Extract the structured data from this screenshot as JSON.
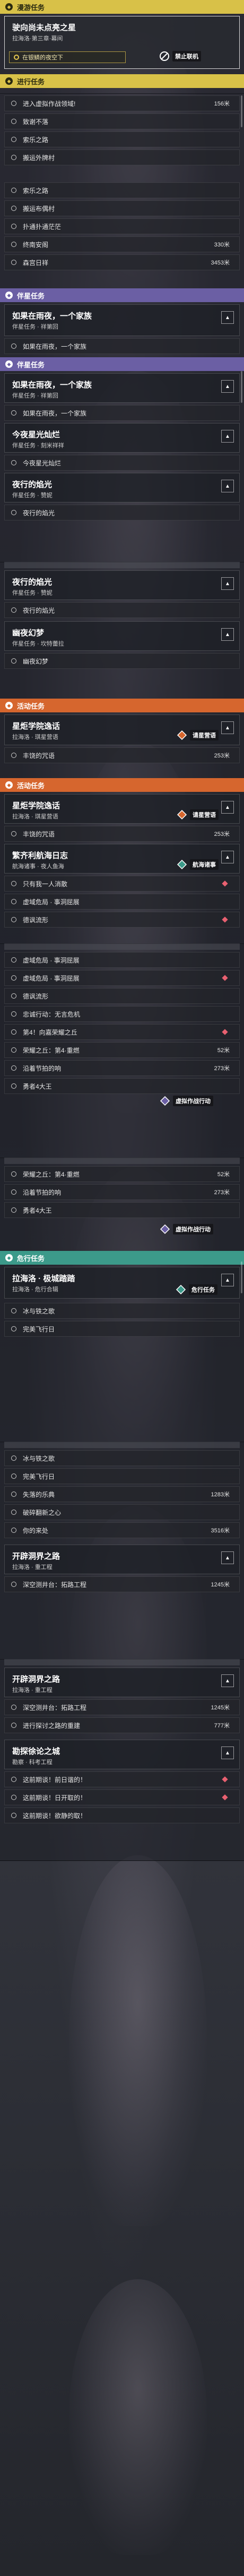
{
  "strings": {
    "header_travel": "漫游任务",
    "header_progress": "进行任务",
    "header_companion": "伴星任务",
    "header_activity": "活动任务",
    "header_danger": "危行任务",
    "travel_title": "驶向尚未点亮之星",
    "travel_sub": "拉海洛·第三章·幕间",
    "travel_obj": "在银鳞的夜空下",
    "travel_badge": "禁止联机",
    "pr1": "进入虚拟作战领域!",
    "pr1_dist": "156米",
    "pr2": "致谢不落",
    "pr3": "索乐之路",
    "pr4": "搬运外牌村",
    "pr5": "索乐之路",
    "pr6": "搬运布偶村",
    "pr7": "扑通扑通茫茫",
    "pr8": "终南安阁",
    "pr8_dist": "330米",
    "pr9": "森宫日祥",
    "pr9_dist": "3453米",
    "c1_title": "如果在雨夜，一个家族",
    "c1_sub": "伴星任务 · 祥第回",
    "c1_row": "如果在雨夜，一个家族",
    "c2_title": "如果在雨夜，一个家族",
    "c2_sub": "伴星任务 · 祥第回",
    "c2_row": "如果在雨夜，一个家族",
    "c3_title": "今夜星光灿烂",
    "c3_sub": "伴星任务 · 刻米祥祥",
    "c3_row": "今夜星光灿烂",
    "c4_title": "夜行的焰光",
    "c4_sub": "伴星任务 · 赞妮",
    "c4_row": "夜行的焰光",
    "c5_title": "夜行的焰光",
    "c5_sub": "伴星任务 · 赞妮",
    "c5_row": "夜行的焰光",
    "c6_title": "幽夜幻梦",
    "c6_sub": "伴星任务 · 坎特蕾拉",
    "c6_row": "幽夜幻梦",
    "a1_title": "星炬学院逸话",
    "a1_sub": "拉海洛 · 琪星营语",
    "a1_row": "丰饶的咒语",
    "a1_dist": "253米",
    "a1_badge": "请星营语",
    "a2_title": "星炬学院逸话",
    "a2_sub": "拉海洛 · 琪星营语",
    "a2_row": "丰饶的咒语",
    "a2_dist": "253米",
    "a2_badge": "请星营语",
    "a3_title": "繁齐利航海日志",
    "a3_sub": "航海诸事 · 夜人鱼海",
    "a3_badge": "航海诸事",
    "a3_r1": "只有我一人消散",
    "a3_r2": "虚域危局 · 事洞屈展",
    "a3_r3": "德讽流形",
    "frag1": "虚域危局 · 事洞屈展",
    "frag2": "虚域危局 · 事洞屈展",
    "frag3": "德讽流形",
    "frag4": "忠诚行动：无言危机",
    "frag5": "第4！向嘉荣耀之丘",
    "frag6": "荣耀之丘：第4·重燃",
    "frag6_dist": "52米",
    "frag7": "沿着节拍的响",
    "frag7_dist": "273米",
    "frag8": "勇者4大王",
    "frag_badge": "虚拟作战行动",
    "f2_1": "荣耀之丘：第4·重燃",
    "f2_1_dist": "52米",
    "f2_2": "沿着节拍的响",
    "f2_2_dist": "273米",
    "f2_3": "勇者4大王",
    "f2_badge": "虚拟作战行动",
    "d1_title": "拉海洛 · 极城踏踏",
    "d1_sub": "拉海洛 · 危行合辑",
    "d1_r1": "冰与铁之歌",
    "d1_r2": "完美飞行日",
    "d1_badge": "危行任务",
    "d2_r1": "冰与铁之歌",
    "d2_r2": "完美飞行日",
    "d2_r3": "失落的乐典",
    "d2_r3_dist": "1283米",
    "d2_r4": "破碎翻新之心",
    "d2_r5": "你的来处",
    "d2_r5_dist": "3516米",
    "e1_title": "开辟洞界之路",
    "e1_sub": "拉海洛 · 重工程",
    "e1_row": "深空测井台：拓路工程",
    "e1_dist": "1245米",
    "e2_title": "开辟洞界之路",
    "e2_sub": "拉海洛 · 重工程",
    "e2_r1": "深空测井台：拓路工程",
    "e2_r1_dist": "1245米",
    "e2_r2": "进行探讨之路的重建",
    "e2_r2_dist": "777米",
    "g1_title": "勘探徐论之城",
    "g1_sub": "勘察 · 科考工程",
    "g1_r1": "这前期谈！前日谐的！",
    "g1_r2": "这前期谈！日开取的！",
    "g1_r3": "这前期谈！欲静的取！"
  },
  "colors": {
    "travel": "#d8c148",
    "companion": "#6b5fa4",
    "activity": "#d6662e",
    "danger": "#3c9a8a",
    "marker": "#e86070"
  },
  "icons": {
    "quest": "diamond-icon",
    "toggle": "chevron-icon",
    "objective": "circle-icon",
    "lock": "no-multiplayer-icon",
    "activity": "activity-badge-icon"
  }
}
